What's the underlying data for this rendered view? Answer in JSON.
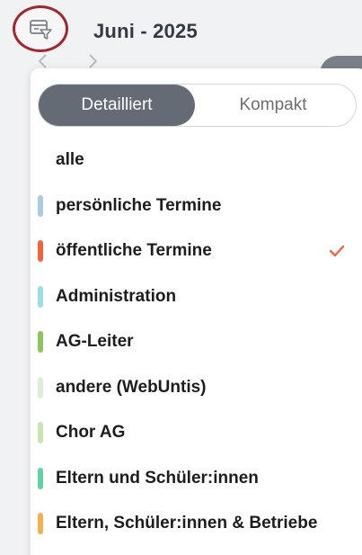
{
  "header": {
    "month_title": "Juni - 2025",
    "prev_icon": "chevron-left-icon",
    "next_icon": "chevron-right-icon",
    "filter_icon": "calendar-filter-icon"
  },
  "view_toggle": {
    "options": [
      "Detailliert",
      "Kompakt"
    ],
    "selected": "Detailliert"
  },
  "categories": [
    {
      "label": "alle",
      "color": null,
      "checked": false
    },
    {
      "label": "persönliche Termine",
      "color": "#a9cbe6",
      "checked": false
    },
    {
      "label": "öffentliche Termine",
      "color": "#f4643c",
      "checked": true
    },
    {
      "label": "Administration",
      "color": "#9adde6",
      "checked": false
    },
    {
      "label": "AG-Leiter",
      "color": "#8cc35a",
      "checked": false
    },
    {
      "label": "andere (WebUntis)",
      "color": "#dcefd6",
      "checked": false
    },
    {
      "label": "Chor AG",
      "color": "#c8e6b4",
      "checked": false
    },
    {
      "label": "Eltern und Schüler:innen",
      "color": "#5fd3a5",
      "checked": false
    },
    {
      "label": "Eltern, Schüler:innen & Betriebe",
      "color": "#f4b050",
      "checked": false
    }
  ],
  "colors": {
    "accent_check": "#f4643c",
    "toggle_active_bg": "#646b75",
    "highlight_ring": "#a3262f"
  }
}
